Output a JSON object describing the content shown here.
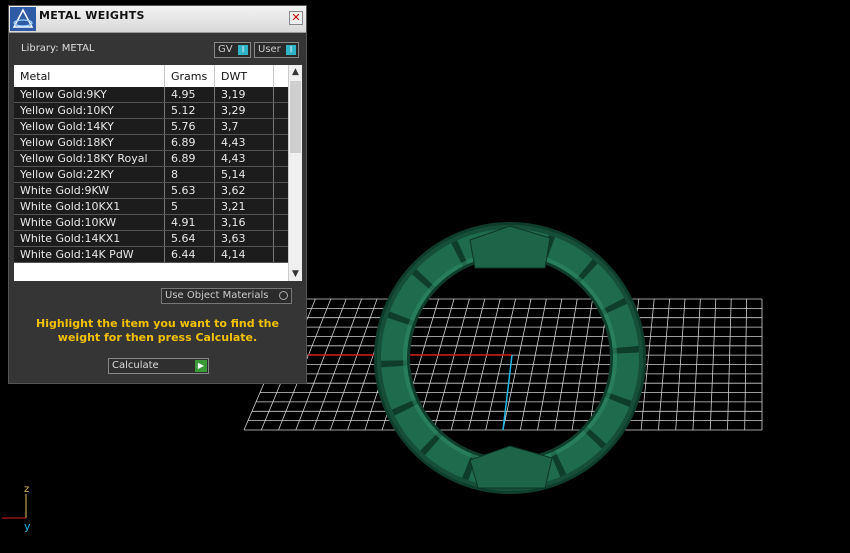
{
  "panel": {
    "title": "METAL WEIGHTS",
    "close_glyph": "✕",
    "library_label": "Library: METAL",
    "toggles": [
      {
        "label": "GV",
        "knob": "I"
      },
      {
        "label": "User",
        "knob": "I"
      }
    ],
    "table": {
      "columns": [
        "Metal",
        "Grams",
        "DWT"
      ],
      "rows": [
        {
          "metal": "Yellow Gold:9KY",
          "grams": "4.95",
          "dwt": "3,19"
        },
        {
          "metal": "Yellow Gold:10KY",
          "grams": "5.12",
          "dwt": "3,29"
        },
        {
          "metal": "Yellow Gold:14KY",
          "grams": "5.76",
          "dwt": "3,7"
        },
        {
          "metal": "Yellow Gold:18KY",
          "grams": "6.89",
          "dwt": "4,43"
        },
        {
          "metal": "Yellow Gold:18KY Royal",
          "grams": "6.89",
          "dwt": "4,43"
        },
        {
          "metal": "Yellow Gold:22KY",
          "grams": "8",
          "dwt": "5,14"
        },
        {
          "metal": "White Gold:9KW",
          "grams": "5.63",
          "dwt": "3,62"
        },
        {
          "metal": "White Gold:10KX1",
          "grams": "5",
          "dwt": "3,21"
        },
        {
          "metal": "White Gold:10KW",
          "grams": "4.91",
          "dwt": "3,16"
        },
        {
          "metal": "White Gold:14KX1",
          "grams": "5.64",
          "dwt": "3,63"
        },
        {
          "metal": "White Gold:14K PdW",
          "grams": "6.44",
          "dwt": "4,14"
        }
      ],
      "scroll_up_glyph": "▲",
      "scroll_down_glyph": "▼"
    },
    "use_object_materials": "Use Object Materials",
    "instruction": "Highlight the item you want to find the weight for then press Calculate.",
    "calculate_label": "Calculate",
    "calculate_arrow": "▶"
  },
  "axes": {
    "z": "z",
    "y": "y"
  },
  "icons": [
    "app-logo-icon",
    "close-icon",
    "scroll-up-icon",
    "scroll-down-icon",
    "play-arrow-icon"
  ],
  "colors": {
    "ring": "#1f6b4e",
    "instruction": "#f2c200",
    "toggle_knob": "#2fb4c8"
  }
}
